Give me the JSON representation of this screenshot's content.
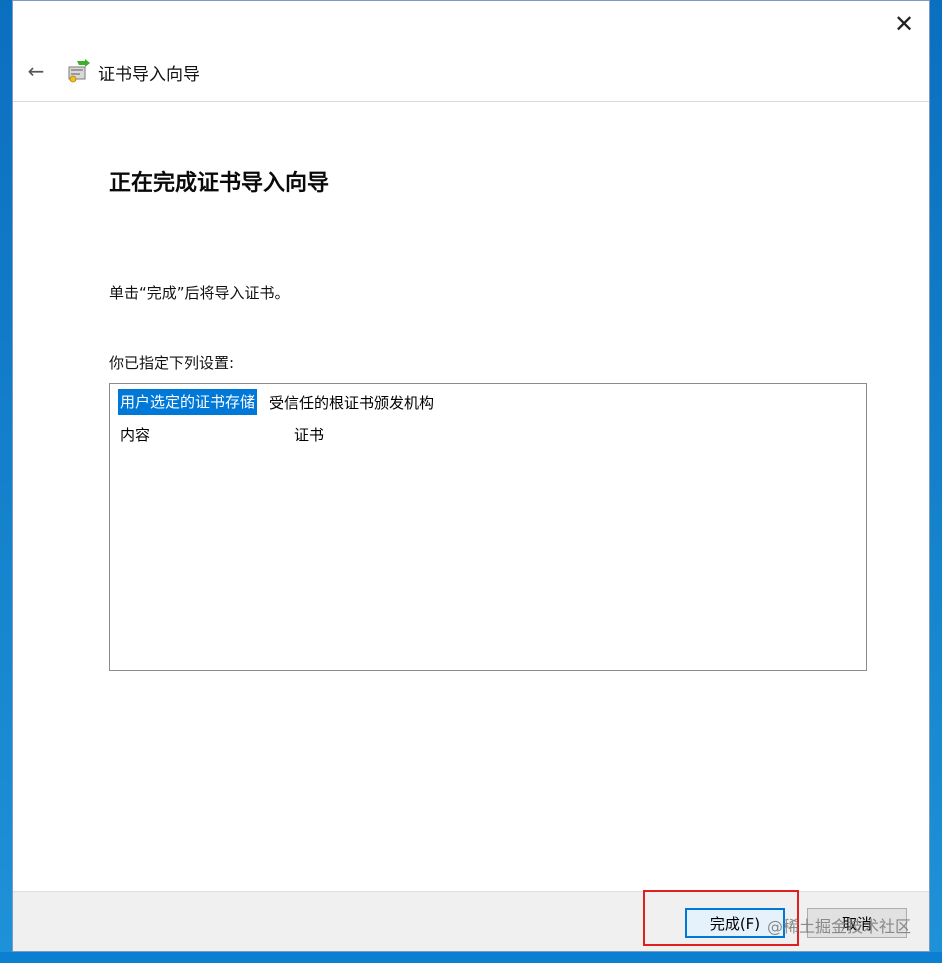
{
  "window": {
    "close_icon": "✕"
  },
  "nav": {
    "back_icon": "←",
    "title": "证书导入向导"
  },
  "heading": "正在完成证书导入向导",
  "instruction": "单击“完成”后将导入证书。",
  "settings_label": "你已指定下列设置:",
  "settings": [
    {
      "key": "用户选定的证书存储",
      "value": "受信任的根证书颁发机构"
    },
    {
      "key": "内容",
      "value": "证书"
    }
  ],
  "footer": {
    "finish_label": "完成(F)",
    "cancel_label": "取消"
  },
  "watermark": "@稀土掘金技术社区",
  "colors": {
    "accent": "#0078d7",
    "highlight": "#e02020"
  }
}
